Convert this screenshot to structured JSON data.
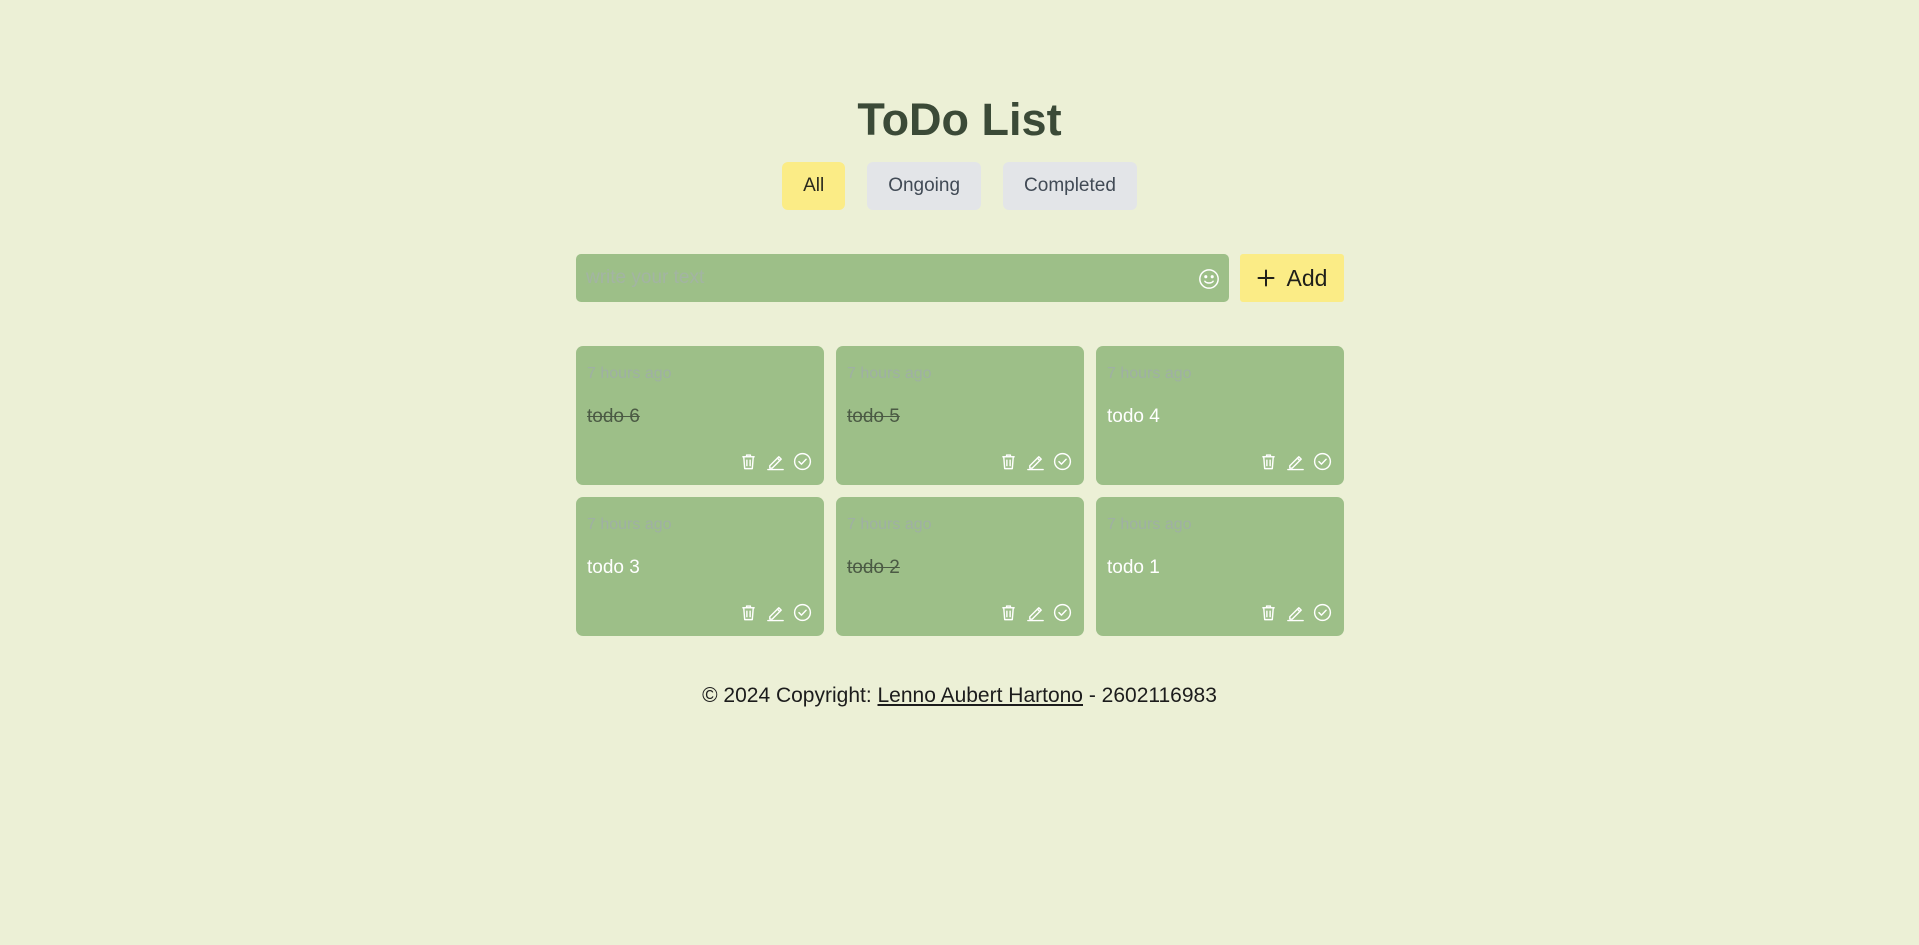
{
  "app": {
    "title": "ToDo List"
  },
  "filters": [
    {
      "label": "All",
      "active": true
    },
    {
      "label": "Ongoing",
      "active": false
    },
    {
      "label": "Completed",
      "active": false
    }
  ],
  "input": {
    "placeholder": "write your text",
    "value": "",
    "emoji_icon": "smiley-icon"
  },
  "add_button": {
    "label": "Add",
    "icon": "plus-icon"
  },
  "todos": [
    {
      "time": "7 hours ago",
      "text": "todo 6",
      "completed": true
    },
    {
      "time": "7 hours ago",
      "text": "todo 5",
      "completed": true
    },
    {
      "time": "7 hours ago",
      "text": "todo 4",
      "completed": false
    },
    {
      "time": "7 hours ago",
      "text": "todo 3",
      "completed": false
    },
    {
      "time": "7 hours ago",
      "text": "todo 2",
      "completed": true
    },
    {
      "time": "7 hours ago",
      "text": "todo 1",
      "completed": false
    }
  ],
  "card_actions": [
    "trash-icon",
    "pencil-icon",
    "check-circle-icon"
  ],
  "footer": {
    "prefix": "© 2024 Copyright: ",
    "author": "Lenno Aubert Hartono",
    "suffix": " - 2602116983"
  },
  "colors": {
    "background": "#ecf0d6",
    "card": "#9dbf88",
    "accent": "#fbec86",
    "title": "#3b4a37"
  }
}
